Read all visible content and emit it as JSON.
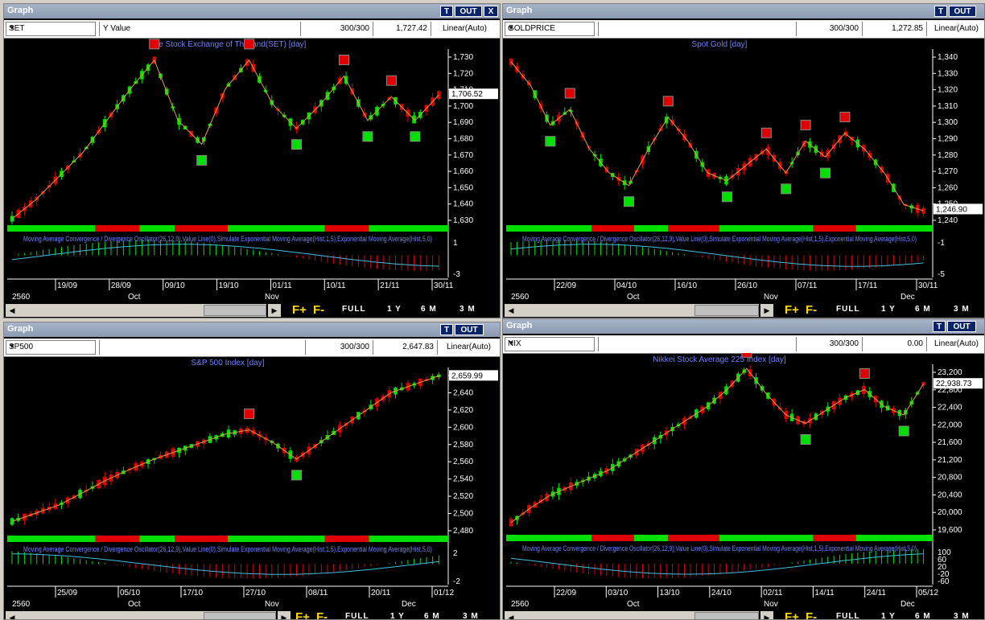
{
  "window_buttons": {
    "t": "T",
    "out": "OUT",
    "x": "X"
  },
  "nav": {
    "full": "FULL",
    "y1": "1 Y",
    "m6": "6 M",
    "m3": "3 M",
    "fplus": "F+",
    "fminus": "F-",
    "left": "◀",
    "right": "▶"
  },
  "panels": [
    {
      "title": "Graph",
      "symbol": "SET",
      "ylabel_field": "Y Value",
      "count": "300/300",
      "value": "1,727.42",
      "scale": "Linear(Auto)",
      "chart_title": "The Stock Exchange of Thailand(SET) [day]",
      "last_price": "1,706.52",
      "macd_label": "Moving Average Convergence / Divergence Oscillator(26,12,9),Value Line(0),Simulate Exponential Moving Average(Hist,1,5),Exponential Moving Average(Hist,5,0)",
      "y_ticks": [
        "1,730",
        "1,720",
        "1,710",
        "1,700",
        "1,690",
        "1,680",
        "1,670",
        "1,660",
        "1,650",
        "1,640",
        "1,630"
      ],
      "macd_ticks": [
        "1",
        "-3"
      ],
      "x_ticks": [
        "19/09",
        "28/09",
        "09/10",
        "19/10",
        "01/11",
        "10/11",
        "21/11",
        "30/11"
      ],
      "year": "2560",
      "months": [
        "Oct",
        "Nov"
      ],
      "chart_data": {
        "type": "candlestick",
        "ylim": [
          1625,
          1735
        ],
        "close_last": 1706.52,
        "trend": [
          1628,
          1640,
          1655,
          1670,
          1690,
          1710,
          1728,
          1690,
          1675,
          1710,
          1728,
          1700,
          1685,
          1700,
          1718,
          1690,
          1705,
          1690,
          1706
        ]
      }
    },
    {
      "title": "Graph",
      "symbol": "GOLDPRICE",
      "ylabel_field": "",
      "count": "300/300",
      "value": "1,272.85",
      "scale": "Linear(Auto)",
      "chart_title": "Spot Gold [day]",
      "last_price": "1,246.90",
      "macd_label": "Moving Average Convergence / Divergence Oscillator(26,12,9),Value Line(0),Simulate Exponential Moving Average(Hist,1,5),Exponential Moving Average(Hist,5,0)",
      "y_ticks": [
        "1,340",
        "1,330",
        "1,320",
        "1,310",
        "1,300",
        "1,290",
        "1,280",
        "1,270",
        "1,260",
        "1,250",
        "1,240"
      ],
      "macd_ticks": [
        "-1",
        "-5"
      ],
      "x_ticks": [
        "22/09",
        "04/10",
        "16/10",
        "26/10",
        "07/11",
        "17/11",
        "30/11"
      ],
      "year": "2560",
      "months": [
        "Oct",
        "Nov",
        "Dec"
      ],
      "chart_data": {
        "type": "candlestick",
        "ylim": [
          1238,
          1348
        ],
        "close_last": 1246.9,
        "trend": [
          1340,
          1325,
          1300,
          1310,
          1285,
          1270,
          1262,
          1285,
          1305,
          1290,
          1270,
          1265,
          1275,
          1285,
          1270,
          1290,
          1280,
          1295,
          1285,
          1270,
          1250,
          1246
        ]
      }
    },
    {
      "title": "Graph",
      "symbol": "SP500",
      "ylabel_field": "",
      "count": "300/300",
      "value": "2,647.83",
      "scale": "Linear(Auto)",
      "chart_title": "S&P 500 Index [day]",
      "last_price": "2,659.99",
      "macd_label": "Moving Average Convergence / Divergence Oscillator(26,12,9),Value Line(0),Simulate Exponential Moving Average(Hist,1,5),Exponential Moving Average(Hist,5,0)",
      "y_ticks": [
        "2,660",
        "2,640",
        "2,620",
        "2,600",
        "2,580",
        "2,560",
        "2,540",
        "2,520",
        "2,500",
        "2,480"
      ],
      "macd_ticks": [
        "2",
        "-2"
      ],
      "x_ticks": [
        "25/09",
        "05/10",
        "17/10",
        "27/10",
        "08/11",
        "20/11",
        "01/12"
      ],
      "year": "2560",
      "months": [
        "Oct",
        "Nov",
        "Dec"
      ],
      "chart_data": {
        "type": "candlestick",
        "ylim": [
          2470,
          2670
        ],
        "close_last": 2659.99,
        "trend": [
          2485,
          2495,
          2505,
          2520,
          2535,
          2548,
          2560,
          2570,
          2580,
          2590,
          2595,
          2580,
          2560,
          2580,
          2600,
          2620,
          2640,
          2650,
          2660
        ]
      }
    },
    {
      "title": "Graph",
      "symbol": "NIX",
      "ylabel_field": "",
      "count": "300/300",
      "value": "0.00",
      "scale": "Linear(Auto)",
      "chart_title": "Nikkei Stock Average 225 Index [day]",
      "last_price": "22,938.73",
      "macd_label": "Moving Average Convergence / Divergence Oscillator(26,12,9),Value Line(0),Simulate Exponential Moving Average(Hist,1,5),Exponential Moving Average(Hist,5,0)",
      "y_ticks": [
        "23,200",
        "22,800",
        "22,400",
        "22,000",
        "21,600",
        "21,200",
        "20,800",
        "20,400",
        "20,000",
        "19,600"
      ],
      "macd_ticks": [
        "100",
        "60",
        "20",
        "-20",
        "-60"
      ],
      "x_ticks": [
        "22/09",
        "03/10",
        "13/10",
        "24/10",
        "02/11",
        "14/11",
        "24/11",
        "05/12"
      ],
      "year": "2560",
      "months": [
        "Oct",
        "Nov",
        "Dec"
      ],
      "chart_data": {
        "type": "candlestick",
        "ylim": [
          19400,
          23400
        ],
        "close_last": 22938.73,
        "trend": [
          19650,
          20000,
          20300,
          20500,
          20700,
          20900,
          21200,
          21500,
          21800,
          22100,
          22400,
          22800,
          23300,
          22700,
          22200,
          22000,
          22300,
          22600,
          22800,
          22400,
          22200,
          22938
        ]
      }
    }
  ],
  "colors": {
    "up": "#00e000",
    "down": "#e00000",
    "trend": "#e0a040",
    "text": "#ffffff",
    "title": "#7080ff",
    "macd_line": "#40c0e0",
    "signal_buy": "#00e000",
    "signal_sell": "#e00000"
  }
}
